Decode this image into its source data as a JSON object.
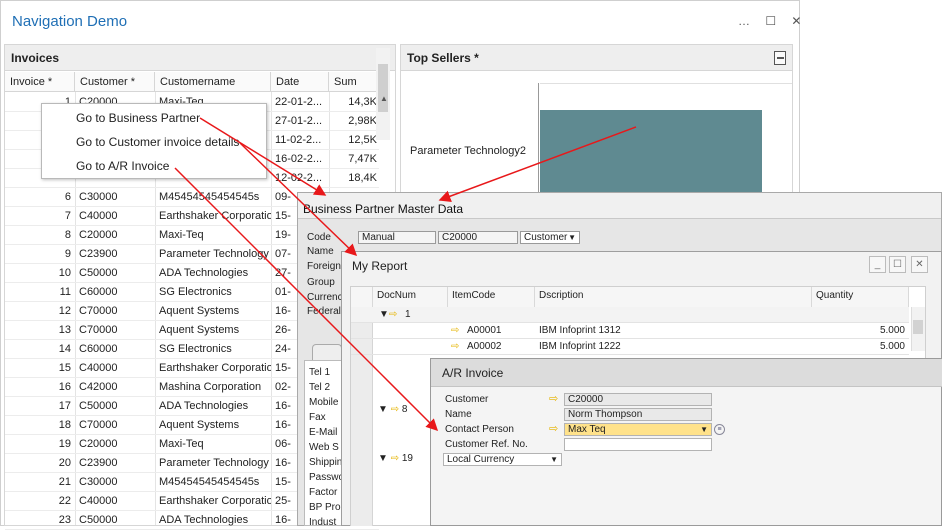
{
  "window": {
    "title": "Navigation Demo",
    "controls": "… ☐ ✕"
  },
  "invoices": {
    "title": "Invoices",
    "columns": [
      "Invoice *",
      "Customer *",
      "Customername",
      "Date",
      "Sum"
    ],
    "rows": [
      {
        "n": "1",
        "c": "C20000",
        "name": "Maxi-Teq",
        "date": "22-01-2...",
        "sum": "14,3K"
      },
      {
        "n": "",
        "c": "",
        "name": "",
        "date": "27-01-2...",
        "sum": "2,98K"
      },
      {
        "n": "",
        "c": "",
        "name": "",
        "date": "11-02-2...",
        "sum": "12,5K"
      },
      {
        "n": "",
        "c": "",
        "name": "",
        "date": "16-02-2...",
        "sum": "7,47K"
      },
      {
        "n": "",
        "c": "",
        "name": "",
        "date": "12-02-2...",
        "sum": "18,4K"
      },
      {
        "n": "6",
        "c": "C30000",
        "name": "M45454545454545s",
        "date": "09-",
        "sum": ""
      },
      {
        "n": "7",
        "c": "C40000",
        "name": "Earthshaker Corporation",
        "date": "15-",
        "sum": ""
      },
      {
        "n": "8",
        "c": "C20000",
        "name": "Maxi-Teq",
        "date": "19-",
        "sum": ""
      },
      {
        "n": "9",
        "c": "C23900",
        "name": "Parameter Technology",
        "date": "07-",
        "sum": ""
      },
      {
        "n": "10",
        "c": "C50000",
        "name": "ADA Technologies",
        "date": "27-",
        "sum": ""
      },
      {
        "n": "11",
        "c": "C60000",
        "name": "SG Electronics",
        "date": "01-",
        "sum": ""
      },
      {
        "n": "12",
        "c": "C70000",
        "name": "Aquent Systems",
        "date": "16-",
        "sum": ""
      },
      {
        "n": "13",
        "c": "C70000",
        "name": "Aquent Systems",
        "date": "26-",
        "sum": ""
      },
      {
        "n": "14",
        "c": "C60000",
        "name": "SG Electronics",
        "date": "24-",
        "sum": ""
      },
      {
        "n": "15",
        "c": "C40000",
        "name": "Earthshaker Corporation",
        "date": "15-",
        "sum": ""
      },
      {
        "n": "16",
        "c": "C42000",
        "name": "Mashina Corporation",
        "date": "02-",
        "sum": ""
      },
      {
        "n": "17",
        "c": "C50000",
        "name": "ADA Technologies",
        "date": "16-",
        "sum": ""
      },
      {
        "n": "18",
        "c": "C70000",
        "name": "Aquent Systems",
        "date": "16-",
        "sum": ""
      },
      {
        "n": "19",
        "c": "C20000",
        "name": "Maxi-Teq",
        "date": "06-",
        "sum": ""
      },
      {
        "n": "20",
        "c": "C23900",
        "name": "Parameter Technology",
        "date": "16-",
        "sum": ""
      },
      {
        "n": "21",
        "c": "C30000",
        "name": "M45454545454545s",
        "date": "15-",
        "sum": ""
      },
      {
        "n": "22",
        "c": "C40000",
        "name": "Earthshaker Corporation",
        "date": "25-",
        "sum": ""
      },
      {
        "n": "23",
        "c": "C50000",
        "name": "ADA Technologies",
        "date": "16-",
        "sum": ""
      }
    ]
  },
  "context_menu": {
    "items": [
      "Go to Business Partner",
      "Go to Customer invoice details",
      "Go to A/R Invoice"
    ]
  },
  "top_sellers": {
    "title": "Top Sellers *",
    "category": "Parameter Technology2"
  },
  "bp": {
    "title": "Business Partner Master Data",
    "labels": [
      "Code",
      "Name",
      "Foreign",
      "Group",
      "Currency",
      "Federal"
    ],
    "code_type": "Manual",
    "code": "C20000",
    "bp_type": "Customer",
    "contact_labels": [
      "Tel 1",
      "Tel 2",
      "Mobile",
      "Fax",
      "E-Mail",
      "Web S",
      "Shipping",
      "Password",
      "Factor",
      "BP Pro",
      "Indust"
    ]
  },
  "report": {
    "title": "My Report",
    "columns": [
      "DocNum",
      "ItemCode",
      "Dscription",
      "Quantity"
    ],
    "groups": [
      {
        "doc": "1"
      },
      {
        "doc": "8"
      },
      {
        "doc": "19"
      }
    ],
    "rows": [
      {
        "code": "A00001",
        "desc": "IBM Infoprint 1312",
        "qty": "5.000"
      },
      {
        "code": "A00002",
        "desc": "IBM Infoprint 1222",
        "qty": "5.000"
      }
    ]
  },
  "ar": {
    "title": "A/R Invoice",
    "labels": [
      "Customer",
      "Name",
      "Contact Person",
      "Customer Ref. No."
    ],
    "customer": "C20000",
    "name": "Norm Thompson",
    "contact": "Max Teq",
    "ref": "",
    "currency": "Local Currency"
  }
}
